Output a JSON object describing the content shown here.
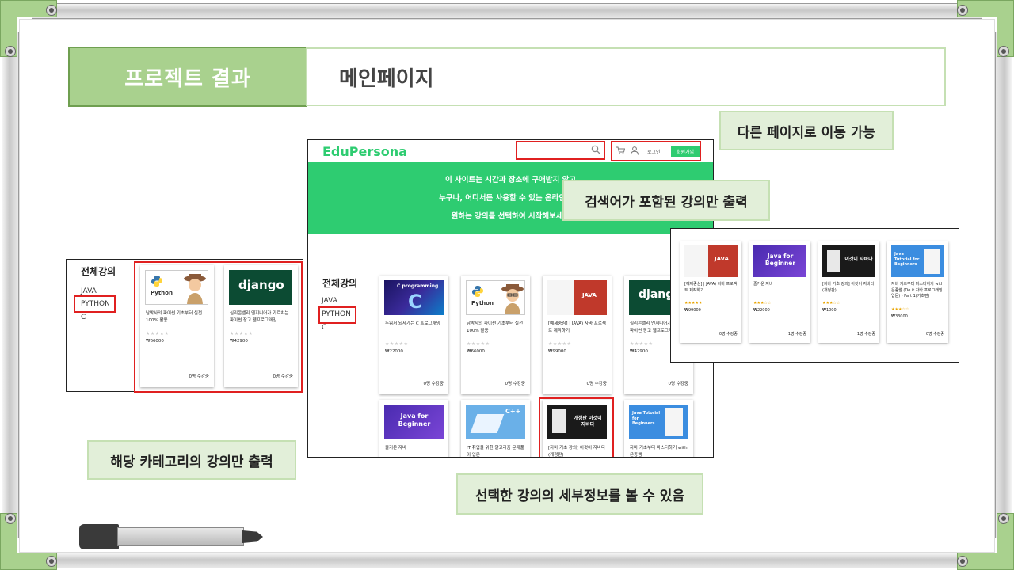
{
  "slide": {
    "title_tag": "프로젝트 결과",
    "title": "메인페이지"
  },
  "notes": {
    "nav": "다른 페이지로 이동 가능",
    "search": "검색어가 포함된 강의만 출력",
    "category": "해당 카테고리의 강의만 출력",
    "detail": "선택한 강의의 세부정보를 볼 수 있음"
  },
  "site": {
    "logo": "EduPersona",
    "login": "로그인",
    "signup": "회원가입",
    "hero_lines": [
      "이 사이트는 시간과 장소에 구애받지 않고",
      "누구나, 어디서든 사용할 수 있는 온라인 강의",
      "원하는 강의를 선택하여 시작해보세요"
    ],
    "sidebar": {
      "title": "전체강의",
      "items": [
        "JAVA",
        "PYTHON",
        "C"
      ]
    },
    "courses": [
      {
        "title": "누워서 뇌세가는 C 프로그래밍",
        "price": "₩22000",
        "enroll": "0명 수강중",
        "thumb_text": "C programming"
      },
      {
        "title": "남박사의 파이썬 기초부터 실전 100% 활용",
        "price": "₩66000",
        "enroll": "0명 수강중",
        "thumb_text": "Python"
      },
      {
        "title": "[예제중심] | JAVA) 자바 프로젝트 제작하기",
        "price": "₩99000",
        "enroll": "0명 수강중",
        "thumb_text": "JAVA"
      },
      {
        "title": "실리콘밸리 엔지니어가 가르치는 파이썬 장고 웹프로그래밍",
        "price": "₩42900",
        "enroll": "0명 수강중",
        "thumb_text": "django"
      },
      {
        "title": "즐거운 자바",
        "thumb_text": "Java for Beginner"
      },
      {
        "title": "IT 취업을 위한 알고리즘 문제풀이 입문",
        "thumb_text": "C++"
      },
      {
        "title": "[자바 기초 강의] 이것이 자바다(개정판)",
        "thumb_text": "개정판 이것이 자바다"
      },
      {
        "title": "자바 기초부터 마스터하기 with 은종쌤",
        "thumb_text": "Java Tutorial for Beginners"
      }
    ]
  },
  "category_crop": {
    "sidebar_title": "전체강의",
    "items": [
      "JAVA",
      "PYTHON",
      "C"
    ],
    "courses": [
      {
        "title": "남박사의 파이썬 기초부터 실전 100% 활용",
        "price": "₩66000",
        "enroll": "0명 수강중",
        "thumb_text": "Python"
      },
      {
        "title": "실리콘밸리 엔지니어가 가르치는 파이썬 장고 웹프로그래밍",
        "price": "₩42900",
        "enroll": "0명 수강중",
        "thumb_text": "django"
      }
    ]
  },
  "search_crop": {
    "courses": [
      {
        "title": "[예제중심] | JAVA) 자바 프로젝트 제작하기",
        "price": "₩99000",
        "enroll": "0명 수강중",
        "thumb_text": "JAVA"
      },
      {
        "title": "즐거운 자바",
        "price": "₩22000",
        "enroll": "1명 수강중",
        "thumb_text": "Java for Beginner"
      },
      {
        "title": "[자바 기초 강의] 이것이 자바다(개정판)",
        "price": "₩1000",
        "enroll": "1명 수강중",
        "thumb_text": "이것이 자바다"
      },
      {
        "title": "자바 기초부터 마스터하기 with 은종쌤 (Do it 자바 프로그래밍 입문) - Part 1(기초편)",
        "price": "₩33000",
        "enroll": "0명 수강중",
        "thumb_text": "Java Tutorial for Beginners"
      }
    ]
  }
}
